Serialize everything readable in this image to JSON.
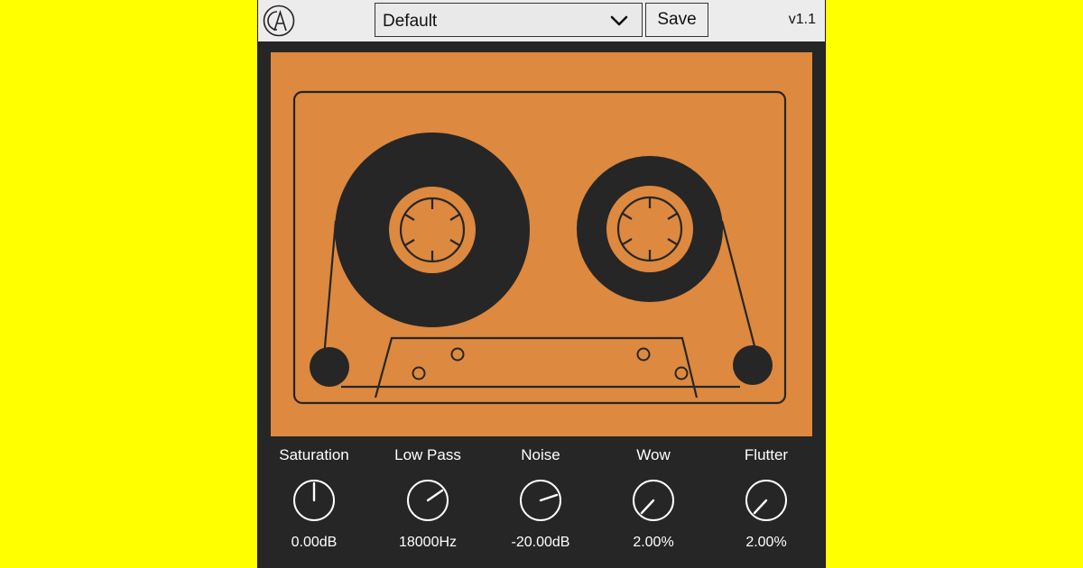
{
  "toolbar": {
    "logo_icon": "ca-logo-icon",
    "preset_value": "Default",
    "preset_chevron_icon": "chevron-down-icon",
    "save_label": "Save",
    "version": "v1.1"
  },
  "cassette": {
    "background": "#dd893f",
    "ink": "#262626"
  },
  "knobs": [
    {
      "title": "Saturation",
      "value": "0.00dB"
    },
    {
      "title": "Low Pass",
      "value": "18000Hz"
    },
    {
      "title": "Noise",
      "value": "-20.00dB"
    },
    {
      "title": "Wow",
      "value": "2.00%"
    },
    {
      "title": "Flutter",
      "value": "2.00%"
    }
  ],
  "colors": {
    "page_background": "#ffff00",
    "plugin_background": "#262626",
    "toolbar_background": "#ececec",
    "label_text": "#ffffff"
  }
}
